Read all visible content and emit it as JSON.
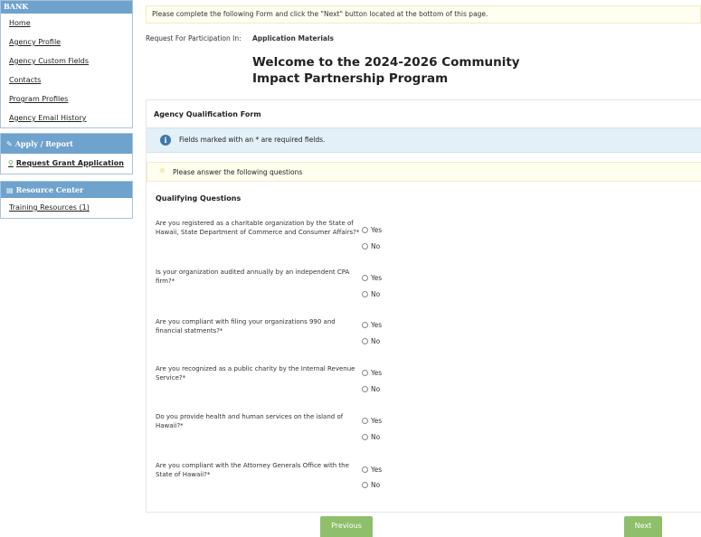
{
  "sidebar": {
    "bank_title": "BANK",
    "links": [
      "Home",
      "Agency Profile",
      "Agency Custom Fields",
      "Contacts",
      "Program Profiles",
      "Agency Email History"
    ],
    "apply_title": "Apply / Report",
    "apply_link": "Request Grant Application",
    "resource_title": "Resource Center",
    "resource_link": "Training Resources (1)"
  },
  "main": {
    "notice": "Please complete the following Form and click the \"Next\" button located at the bottom of this page.",
    "request_label": "Request For Participation In:",
    "request_value": "Application Materials",
    "welcome": "Welcome to the 2024-2026 Community Impact Partnership Program",
    "form_title": "Agency Qualification Form",
    "info_text": "Fields marked with an * are required fields.",
    "warn_text": "Please answer the following questions",
    "questions_heading": "Qualifying Questions",
    "yes_label": "Yes",
    "no_label": "No",
    "questions": [
      "Are you registered as a charitable organization by the State of Hawaii, State Department of Commerce and Consumer Affairs?*",
      "Is your organization audited annually by an independent CPA firm?*",
      "Are you compliant with filing your organizations 990 and financial statments?*",
      "Are you recognized as a public charity by the Internal Revenue Service?*",
      "Do you provide health and human services on the island of Hawaii?*",
      "Are you compliant with the Attorney Generals Office with the State of Hawaii?*"
    ],
    "prev_label": "Previous",
    "next_label": "Next"
  },
  "icons": {
    "info": "info-circle-icon",
    "bulb": "lightbulb-icon",
    "pencil": "pencil-icon",
    "pin": "map-pin-icon",
    "book": "book-icon"
  },
  "colors": {
    "sidebar_header": "#6fa2cc",
    "button": "#8fbf6a",
    "info_bg": "#e3f0f8",
    "notice_bg": "#fffff0"
  }
}
